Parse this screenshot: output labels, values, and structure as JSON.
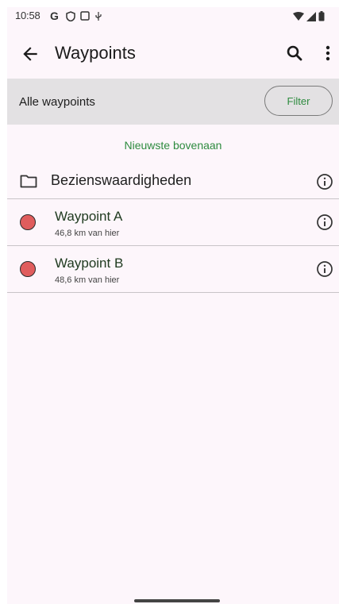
{
  "status_bar": {
    "time": "10:58",
    "icons": [
      "google-icon",
      "shield-icon",
      "screen-icon",
      "usb-icon",
      "wifi-icon",
      "signal-icon",
      "battery-icon"
    ]
  },
  "app_bar": {
    "title": "Waypoints",
    "icons": [
      "back-arrow-icon",
      "search-icon",
      "more-vert-icon"
    ]
  },
  "filter_bar": {
    "label": "Alle waypoints",
    "button_label": "Filter"
  },
  "sort_label": "Nieuwste bovenaan",
  "folder": {
    "title": "Bezienswaardigheden",
    "icon": "folder-icon"
  },
  "waypoints": [
    {
      "name": "Waypoint A",
      "distance": "46,8 km van hier",
      "color": "#e05d5d"
    },
    {
      "name": "Waypoint B",
      "distance": "48,6 km van hier",
      "color": "#e05d5d"
    }
  ],
  "colors": {
    "accent": "#2e8b3f",
    "background": "#fdf6fb",
    "filter_bar": "#e3e1e3"
  }
}
